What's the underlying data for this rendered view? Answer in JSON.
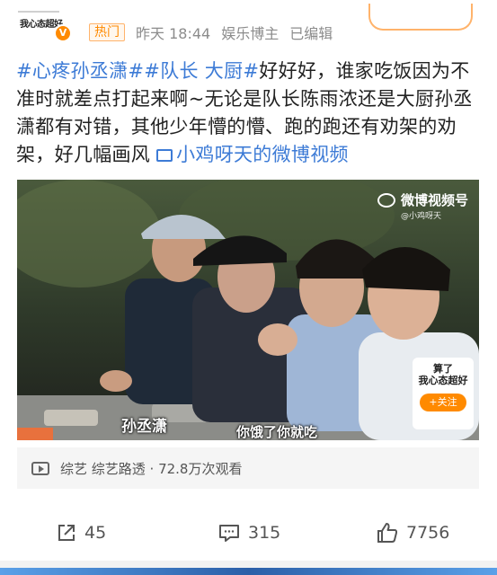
{
  "header": {
    "avatar_text": "我心态超好",
    "verified_mark": "V",
    "hot_label": "热门",
    "time": "昨天 18:44",
    "role": "娱乐博主",
    "edited": "已编辑"
  },
  "post": {
    "tag1": "#心疼孙丞潇#",
    "tag2": "#队长 大厨#",
    "body": "好好好，谁家吃饭因为不准时就差点打起来啊~无论是队长陈雨浓还是大厨孙丞潇都有对错，其他少年懵的懵、跑的跑还有劝架的劝架，好几幅画风",
    "video_link": "小鸡呀天的微博视频"
  },
  "video": {
    "watermark_title": "微博视频号",
    "watermark_sub": "@小鸡呀天",
    "name_caption": "孙丞潇",
    "subtitle": "你饿了你就吃",
    "promo_line1": "算了",
    "promo_line2": "我心态超好",
    "promo_follow": "+关注"
  },
  "category": {
    "text": "综艺 综艺路透 · 72.8万次观看"
  },
  "actions": {
    "share_count": "45",
    "comment_count": "315",
    "like_count": "7756"
  },
  "colors": {
    "link_blue": "#3d7bd6",
    "accent_orange": "#ff8a00"
  }
}
